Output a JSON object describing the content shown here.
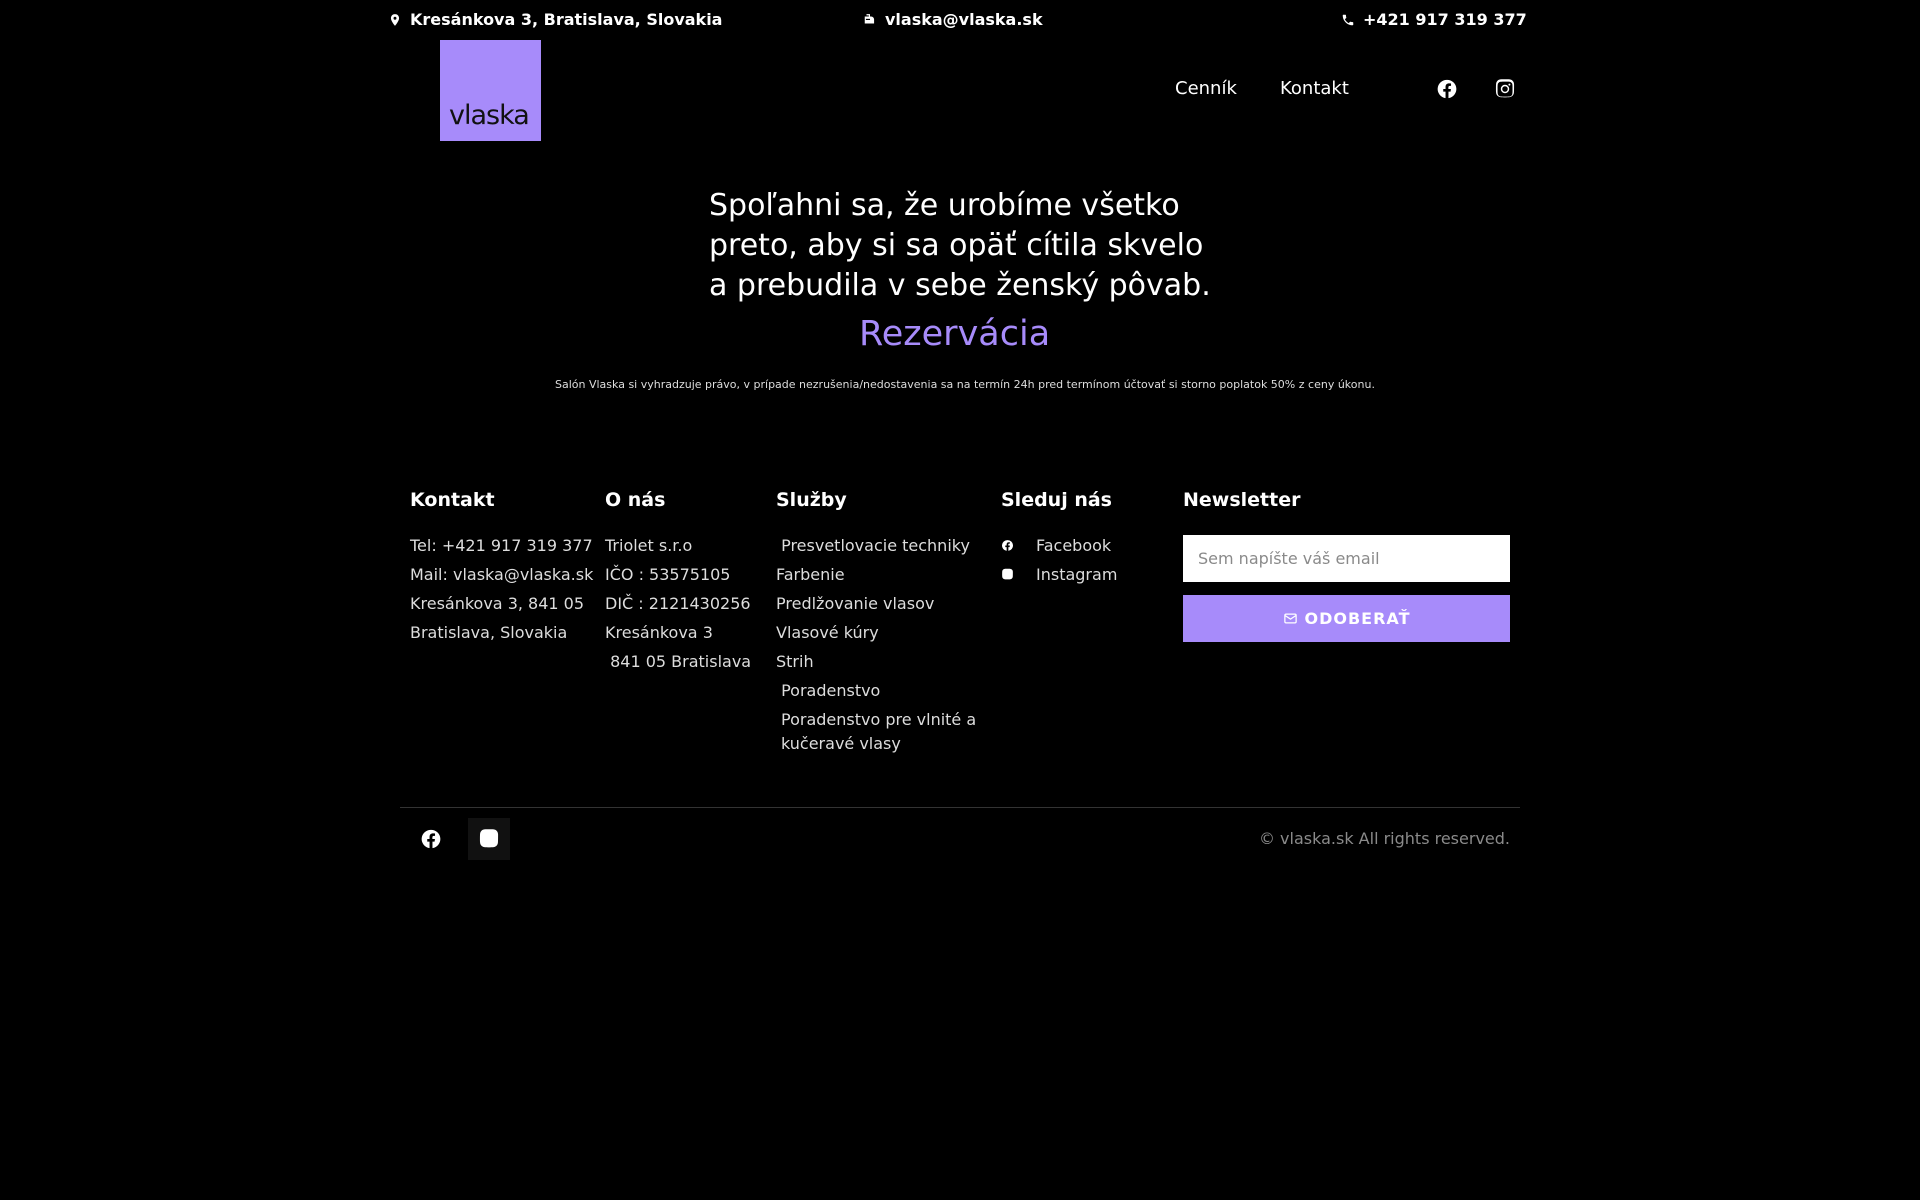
{
  "topbar": {
    "address": "Kresánkova 3, Bratislava, Slovakia",
    "email": "vlaska@vlaska.sk",
    "phone": "+421 917 319 377"
  },
  "header": {
    "logo_text": "vlaska",
    "nav": [
      "Cenník",
      "Kontakt"
    ],
    "social_icons": [
      "facebook-icon",
      "instagram-icon"
    ]
  },
  "hero": {
    "lines": [
      "Spoľahni sa, že urobíme všetko",
      "preto, aby si sa opäť cítila skvelo",
      "a prebudila v sebe ženský pôvab."
    ],
    "cta": "Rezervácia",
    "disclaimer": "Salón Vlaska si vyhradzuje právo, v prípade nezrušenia/nedostavenia sa na termín 24h pred termínom účtovať si storno poplatok 50% z ceny úkonu."
  },
  "footer": {
    "contact": {
      "heading": "Kontakt",
      "items": [
        "Tel: +421 917 319 377",
        "Mail: vlaska@vlaska.sk",
        "Kresánkova 3, 841 05",
        "Bratislava, Slovakia"
      ]
    },
    "about": {
      "heading": "O nás",
      "items": [
        "Triolet s.r.o",
        "IČO : 53575105",
        "DIČ : 2121430256",
        "Kresánkova 3",
        " 841 05 Bratislava"
      ]
    },
    "services": {
      "heading": "Služby",
      "items": [
        " Presvetlovacie techniky",
        "Farbenie",
        "Predlžovanie vlasov",
        "Vlasové kúry",
        "Strih",
        " Poradenstvo",
        "Poradenstvo pre vlnité a kučeravé vlasy"
      ]
    },
    "follow": {
      "heading": "Sleduj nás",
      "items": [
        "Facebook",
        "Instagram"
      ]
    },
    "newsletter": {
      "heading": "Newsletter",
      "placeholder": "Sem napíšte váš email",
      "button_label": "ODOBERAŤ"
    },
    "copyright": "© vlaska.sk All rights reserved."
  },
  "colors": {
    "background": "#000000",
    "accent": "#a78bfa",
    "text": "#ffffff",
    "muted": "#8a8a8a"
  }
}
